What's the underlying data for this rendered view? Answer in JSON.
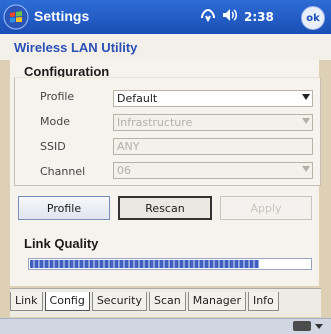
{
  "titlebar": {
    "title": "Settings",
    "status_time": "2:38",
    "ok_label": "ok"
  },
  "app": {
    "title": "Wireless LAN Utility"
  },
  "configuration": {
    "heading": "Configuration",
    "profile_label": "Profile",
    "profile_value": "Default",
    "mode_label": "Mode",
    "mode_value": "Infrastructure",
    "ssid_label": "SSID",
    "ssid_value": "ANY",
    "channel_label": "Channel",
    "channel_value": "06"
  },
  "buttons": {
    "profile": "Profile",
    "rescan": "Rescan",
    "apply": "Apply"
  },
  "link_quality": {
    "heading": "Link Quality",
    "fraction": 0.82
  },
  "tabs": [
    "Link",
    "Config",
    "Security",
    "Scan",
    "Manager",
    "Info"
  ],
  "active_tab": 1
}
